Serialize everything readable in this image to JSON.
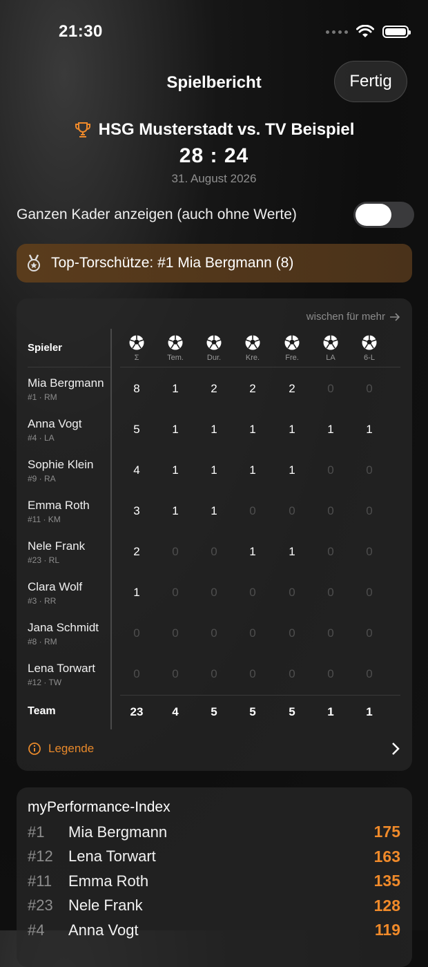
{
  "status_bar": {
    "time": "21:30"
  },
  "header": {
    "title": "Spielbericht",
    "done_label": "Fertig"
  },
  "match": {
    "title": "HSG Musterstadt vs. TV Beispiel",
    "score": "28 : 24",
    "date": "31. August 2026"
  },
  "toggle": {
    "label": "Ganzen Kader anzeigen (auch ohne Werte)",
    "on": false
  },
  "top_scorer": {
    "text": "Top-Torschütze: #1 Mia Bergmann (8)"
  },
  "stats": {
    "swipe_hint": "wischen für mehr",
    "player_header": "Spieler",
    "columns": [
      "Σ",
      "Tem.",
      "Dur.",
      "Kre.",
      "Fre.",
      "LA",
      "6-L"
    ],
    "players": [
      {
        "name": "Mia Bergmann",
        "info": "#1 · RM",
        "values": [
          "8",
          "1",
          "2",
          "2",
          "2",
          "0",
          "0"
        ]
      },
      {
        "name": "Anna Vogt",
        "info": "#4 · LA",
        "values": [
          "5",
          "1",
          "1",
          "1",
          "1",
          "1",
          "1"
        ]
      },
      {
        "name": "Sophie Klein",
        "info": "#9 · RA",
        "values": [
          "4",
          "1",
          "1",
          "1",
          "1",
          "0",
          "0"
        ]
      },
      {
        "name": "Emma Roth",
        "info": "#11 · KM",
        "values": [
          "3",
          "1",
          "1",
          "0",
          "0",
          "0",
          "0"
        ]
      },
      {
        "name": "Nele Frank",
        "info": "#23 · RL",
        "values": [
          "2",
          "0",
          "0",
          "1",
          "1",
          "0",
          "0"
        ]
      },
      {
        "name": "Clara Wolf",
        "info": "#3 · RR",
        "values": [
          "1",
          "0",
          "0",
          "0",
          "0",
          "0",
          "0"
        ]
      },
      {
        "name": "Jana Schmidt",
        "info": "#8 · RM",
        "values": [
          "0",
          "0",
          "0",
          "0",
          "0",
          "0",
          "0"
        ]
      },
      {
        "name": "Lena Torwart",
        "info": "#12 · TW",
        "values": [
          "0",
          "0",
          "0",
          "0",
          "0",
          "0",
          "0"
        ]
      }
    ],
    "team": {
      "label": "Team",
      "values": [
        "23",
        "4",
        "5",
        "5",
        "5",
        "1",
        "1"
      ]
    },
    "legend_label": "Legende"
  },
  "performance": {
    "title": "myPerformance-Index",
    "rows": [
      {
        "rank": "#1",
        "name": "Mia Bergmann",
        "score": "175"
      },
      {
        "rank": "#12",
        "name": "Lena Torwart",
        "score": "163"
      },
      {
        "rank": "#11",
        "name": "Emma Roth",
        "score": "135"
      },
      {
        "rank": "#23",
        "name": "Nele Frank",
        "score": "128"
      },
      {
        "rank": "#4",
        "name": "Anna Vogt",
        "score": "119"
      }
    ]
  },
  "colors": {
    "accent": "#f08a2a",
    "top_scorer_bg": "#5a3c1c",
    "card_bg": "#282828"
  }
}
